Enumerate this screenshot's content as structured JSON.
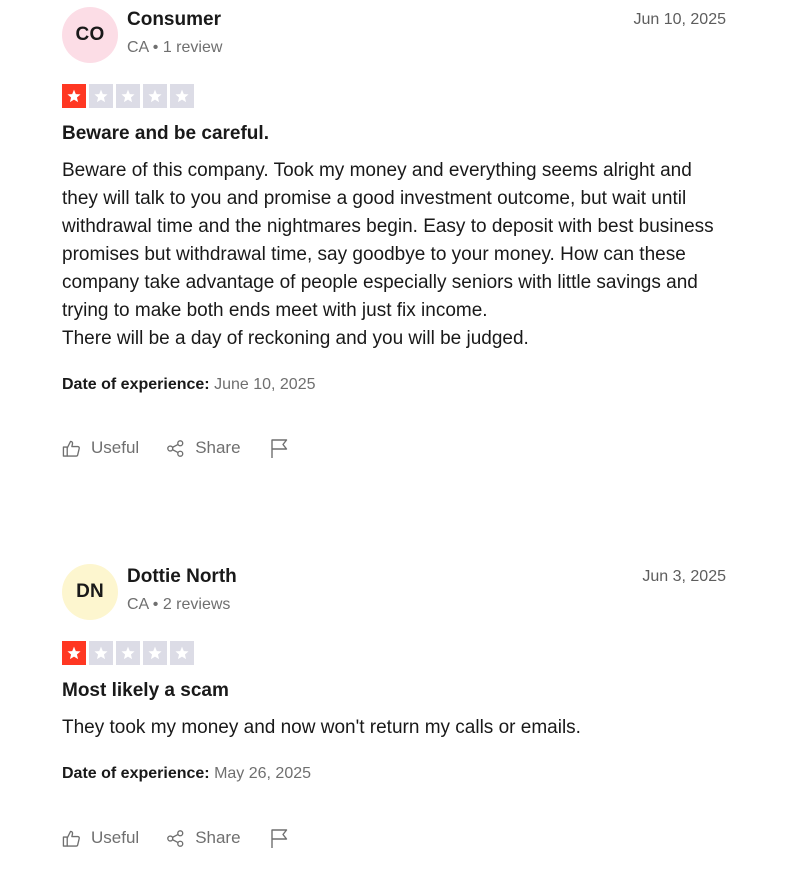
{
  "colors": {
    "star_filled": "#ff3722",
    "star_empty": "#dcdce6",
    "avatar_consumer": "#fcdde6",
    "avatar_dottie": "#fdf6cf",
    "muted_text": "#6f6f6f"
  },
  "reviews": [
    {
      "avatar_initials": "CO",
      "name": "Consumer",
      "meta": "CA • 1 review",
      "date": "Jun 10, 2025",
      "rating": 1,
      "rating_max": 5,
      "title": "Beware and be careful.",
      "body": "Beware of this company. Took my money and everything seems alright and they will talk to you and promise a good investment outcome, but wait until withdrawal time and the nightmares begin. Easy to deposit with best business promises but withdrawal time, say goodbye to your money. How can these company take advantage of people especially seniors with little savings and trying to make both ends meet with just fix income.\nThere will be a day of reckoning and you will be judged.",
      "experience_label": "Date of experience:",
      "experience_date": "June 10, 2025",
      "actions": {
        "useful": "Useful",
        "share": "Share",
        "useful_icon": "thumbs-up-icon",
        "share_icon": "share-icon",
        "flag_icon": "flag-icon"
      }
    },
    {
      "avatar_initials": "DN",
      "name": "Dottie North",
      "meta": "CA • 2 reviews",
      "date": "Jun 3, 2025",
      "rating": 1,
      "rating_max": 5,
      "title": "Most likely a scam",
      "body": "They took my money and now won't return my calls or emails.",
      "experience_label": "Date of experience:",
      "experience_date": "May 26, 2025",
      "actions": {
        "useful": "Useful",
        "share": "Share",
        "useful_icon": "thumbs-up-icon",
        "share_icon": "share-icon",
        "flag_icon": "flag-icon"
      }
    }
  ]
}
